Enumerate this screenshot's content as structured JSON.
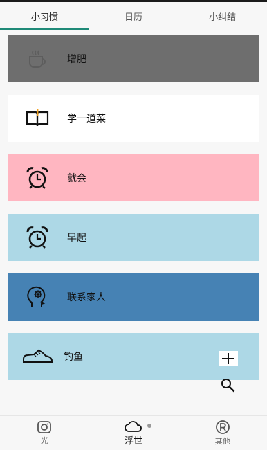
{
  "tabs": [
    {
      "label": "小习惯",
      "active": true
    },
    {
      "label": "日历",
      "active": false
    },
    {
      "label": "小纠结",
      "active": false
    }
  ],
  "habits": [
    {
      "name": "增肥",
      "icon": "coffee-cup-icon",
      "color": "#6e6e6e"
    },
    {
      "name": "学一道菜",
      "icon": "open-book-icon",
      "color": "#ffffff"
    },
    {
      "name": "就会",
      "icon": "alarm-clock-icon",
      "color": "#ffb6c1"
    },
    {
      "name": "早起",
      "icon": "alarm-clock-icon",
      "color": "#add8e6"
    },
    {
      "name": "联系家人",
      "icon": "head-brain-icon",
      "color": "#4682b4"
    },
    {
      "name": "钓鱼",
      "icon": "sneaker-icon",
      "color": "#add8e6"
    }
  ],
  "actions": {
    "add_icon": "plus-icon",
    "search_icon": "search-icon"
  },
  "bottom_nav": [
    {
      "label": "光",
      "icon": "camera-icon",
      "active": false
    },
    {
      "label": "浮世",
      "icon": "cloud-icon",
      "active": true
    },
    {
      "label": "其他",
      "icon": "registered-icon",
      "active": false
    }
  ]
}
